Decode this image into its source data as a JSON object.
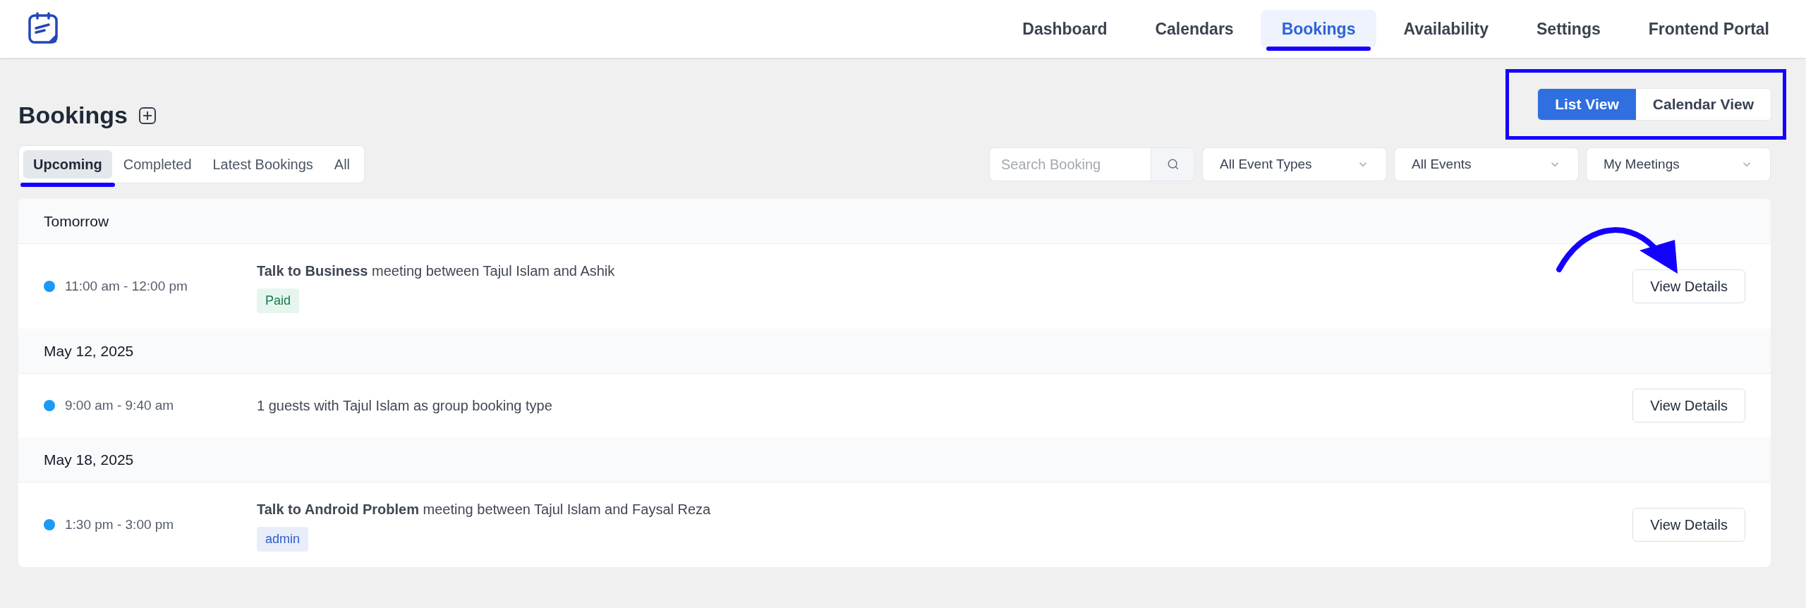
{
  "nav": {
    "items": [
      {
        "label": "Dashboard",
        "selected": false
      },
      {
        "label": "Calendars",
        "selected": false
      },
      {
        "label": "Bookings",
        "selected": true
      },
      {
        "label": "Availability",
        "selected": false
      },
      {
        "label": "Settings",
        "selected": false
      },
      {
        "label": "Frontend Portal",
        "selected": false
      }
    ]
  },
  "page_title": "Bookings",
  "view_toggle": [
    {
      "label": "List View",
      "selected": true
    },
    {
      "label": "Calendar View",
      "selected": false
    }
  ],
  "tabs": [
    {
      "label": "Upcoming",
      "selected": true
    },
    {
      "label": "Completed",
      "selected": false
    },
    {
      "label": "Latest Bookings",
      "selected": false
    },
    {
      "label": "All",
      "selected": false
    }
  ],
  "search": {
    "placeholder": "Search Booking"
  },
  "filters": [
    "All Event Types",
    "All Events",
    "My Meetings"
  ],
  "groups": [
    {
      "date": "Tomorrow",
      "bookings": [
        {
          "time": "11:00 am - 12:00 pm",
          "title": "**Talk to Business** meeting between Tajul Islam and Ashik",
          "tag": {
            "label": "Paid",
            "kind": "payment"
          },
          "button": "View Details",
          "highlighted": true
        }
      ]
    },
    {
      "date": "May 12, 2025",
      "bookings": [
        {
          "time": "9:00 am - 9:40 am",
          "title": "1 guests with Tajul Islam as group booking type",
          "button": "View Details",
          "highlighted": false
        }
      ]
    },
    {
      "date": "May 18, 2025",
      "bookings": [
        {
          "time": "1:30 pm - 3:00 pm",
          "title": "**Talk to Android Problem** meeting between Tajul Islam and Faysal Reza",
          "tag": {
            "label": "admin",
            "kind": "role"
          },
          "button": "View Details",
          "highlighted": false
        }
      ]
    }
  ]
}
